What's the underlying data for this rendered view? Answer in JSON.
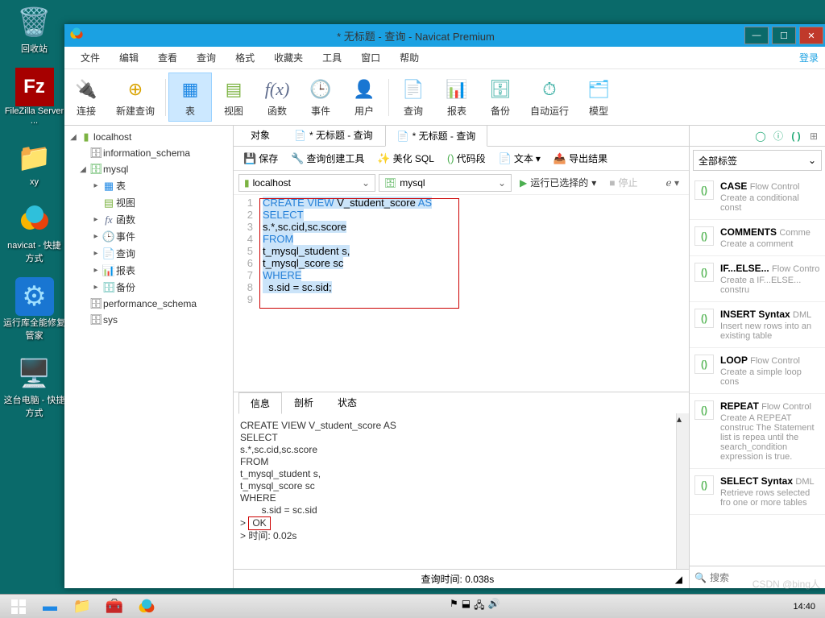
{
  "desktop": {
    "items": [
      {
        "name": "回收站"
      },
      {
        "name": "FileZilla Server ..."
      },
      {
        "name": "xy"
      },
      {
        "name": "navicat - 快捷方式"
      },
      {
        "name": "运行库全能修复管家"
      },
      {
        "name": "这台电脑 - 快捷方式"
      }
    ]
  },
  "window": {
    "title": "* 无标题 - 查询 - Navicat Premium",
    "login": "登录"
  },
  "menus": [
    "文件",
    "编辑",
    "查看",
    "查询",
    "格式",
    "收藏夹",
    "工具",
    "窗口",
    "帮助"
  ],
  "toolbar": [
    {
      "label": "连接"
    },
    {
      "label": "新建查询"
    },
    {
      "label": "表"
    },
    {
      "label": "视图"
    },
    {
      "label": "函数"
    },
    {
      "label": "事件"
    },
    {
      "label": "用户"
    },
    {
      "label": "查询"
    },
    {
      "label": "报表"
    },
    {
      "label": "备份"
    },
    {
      "label": "自动运行"
    },
    {
      "label": "模型"
    }
  ],
  "tree": {
    "host": "localhost",
    "dbs": [
      "information_schema",
      "mysql",
      "performance_schema",
      "sys"
    ],
    "mysql_children": [
      {
        "label": "表"
      },
      {
        "label": "视图"
      },
      {
        "label": "函数"
      },
      {
        "label": "事件"
      },
      {
        "label": "查询"
      },
      {
        "label": "报表"
      },
      {
        "label": "备份"
      }
    ]
  },
  "tabs": {
    "t0": "对象",
    "t1": "* 无标题 - 查询",
    "t2": "* 无标题 - 查询"
  },
  "qtoolbar": {
    "save": "保存",
    "builder": "查询创建工具",
    "beautify": "美化 SQL",
    "segment": "代码段",
    "text": "文本",
    "export": "导出结果"
  },
  "conn": {
    "host": "localhost",
    "db": "mysql",
    "run": "运行已选择的",
    "stop": "停止"
  },
  "code": {
    "lines": [
      "1",
      "2",
      "3",
      "4",
      "5",
      "6",
      "7",
      "8",
      "9"
    ],
    "l1": "",
    "l2a": "CREATE",
    "l2b": "VIEW",
    "l2c": " V_student_score ",
    "l2d": "AS",
    "l3": "SELECT",
    "l4": "s.*,sc.cid,sc.score",
    "l5": "FROM",
    "l6": "t_mysql_student s,",
    "l7": "t_mysql_score sc",
    "l8": "WHERE",
    "l9": "  s.sid = sc.sid;"
  },
  "out_tabs": {
    "t0": "信息",
    "t1": "剖析",
    "t2": "状态"
  },
  "output": {
    "l1": "CREATE VIEW V_student_score AS",
    "l2": "SELECT",
    "l3": "s.*,sc.cid,sc.score",
    "l4": "FROM",
    "l5": "t_mysql_student s,",
    "l6": "t_mysql_score sc",
    "l7": "WHERE",
    "l8": "        s.sid = sc.sid",
    "ok": "OK",
    "time": "> 时间: 0.02s"
  },
  "status": {
    "query_time": "查询时间: 0.038s"
  },
  "right": {
    "filter": "全部标签",
    "search_placeholder": "搜索",
    "snips": [
      {
        "t": "CASE",
        "s": "Flow Control",
        "d": "Create a conditional const"
      },
      {
        "t": "COMMENTS",
        "s": "Comme",
        "d": "Create a comment"
      },
      {
        "t": "IF...ELSE...",
        "s": "Flow Control",
        "d": "Create a IF...ELSE... constru"
      },
      {
        "t": "INSERT Syntax",
        "s": "DML",
        "d": "Insert new rows into an existing table"
      },
      {
        "t": "LOOP",
        "s": "Flow Control",
        "d": "Create a simple loop cons"
      },
      {
        "t": "REPEAT",
        "s": "Flow Control",
        "d": "Create A REPEAT construc The Statement list is repea until the search_condition expression is true."
      },
      {
        "t": "SELECT Syntax",
        "s": "DML",
        "d": "Retrieve rows selected fro one or more tables"
      }
    ]
  },
  "taskbar": {
    "clock": "14:40"
  },
  "watermark": "CSDN @bing人"
}
